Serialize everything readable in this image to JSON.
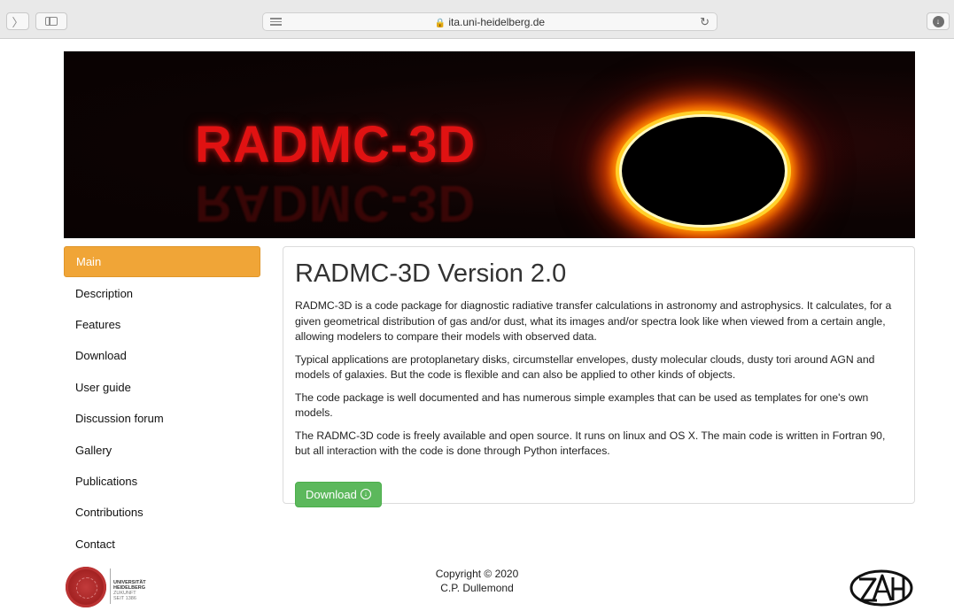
{
  "browser": {
    "url": "ita.uni-heidelberg.de",
    "lock_glyph": "🔒",
    "reload_glyph": "↻",
    "back_glyph": "〉",
    "download_glyph": "↓"
  },
  "banner": {
    "title": "RADMC-3D"
  },
  "nav": {
    "items": [
      {
        "label": "Main",
        "active": true
      },
      {
        "label": "Description"
      },
      {
        "label": "Features"
      },
      {
        "label": "Download"
      },
      {
        "label": "User guide"
      },
      {
        "label": "Discussion forum"
      },
      {
        "label": "Gallery"
      },
      {
        "label": "Publications"
      },
      {
        "label": "Contributions"
      },
      {
        "label": "Contact"
      }
    ]
  },
  "main": {
    "heading": "RADMC-3D Version 2.0",
    "paragraphs": [
      "RADMC-3D is a code package for diagnostic radiative transfer calculations in astronomy and astrophysics. It calculates, for a given geometrical distribution of gas and/or dust, what its images and/or spectra look like when viewed from a certain angle, allowing modelers to compare their models with observed data.",
      "Typical applications are protoplanetary disks, circumstellar envelopes, dusty molecular clouds, dusty tori around AGN and models of galaxies. But the code is flexible and can also be applied to other kinds of objects.",
      "The code package is well documented and has numerous simple examples that can be used as templates for one's own models.",
      "The RADMC-3D code is freely available and open source. It runs on linux and OS X. The main code is written in Fortran 90, but all interaction with the code is done through Python interfaces."
    ],
    "download_button": "Download",
    "download_icon_glyph": "↓"
  },
  "footer": {
    "copyright": "Copyright © 2020",
    "author": "C.P. Dullemond",
    "uni_logo_lines": [
      "UNIVERSITÄT",
      "HEIDELBERG",
      "ZUKUNFT",
      "SEIT 1386"
    ]
  },
  "colors": {
    "nav_active": "#f0a537",
    "download_button": "#5cb85c",
    "banner_title": "#e01212"
  }
}
